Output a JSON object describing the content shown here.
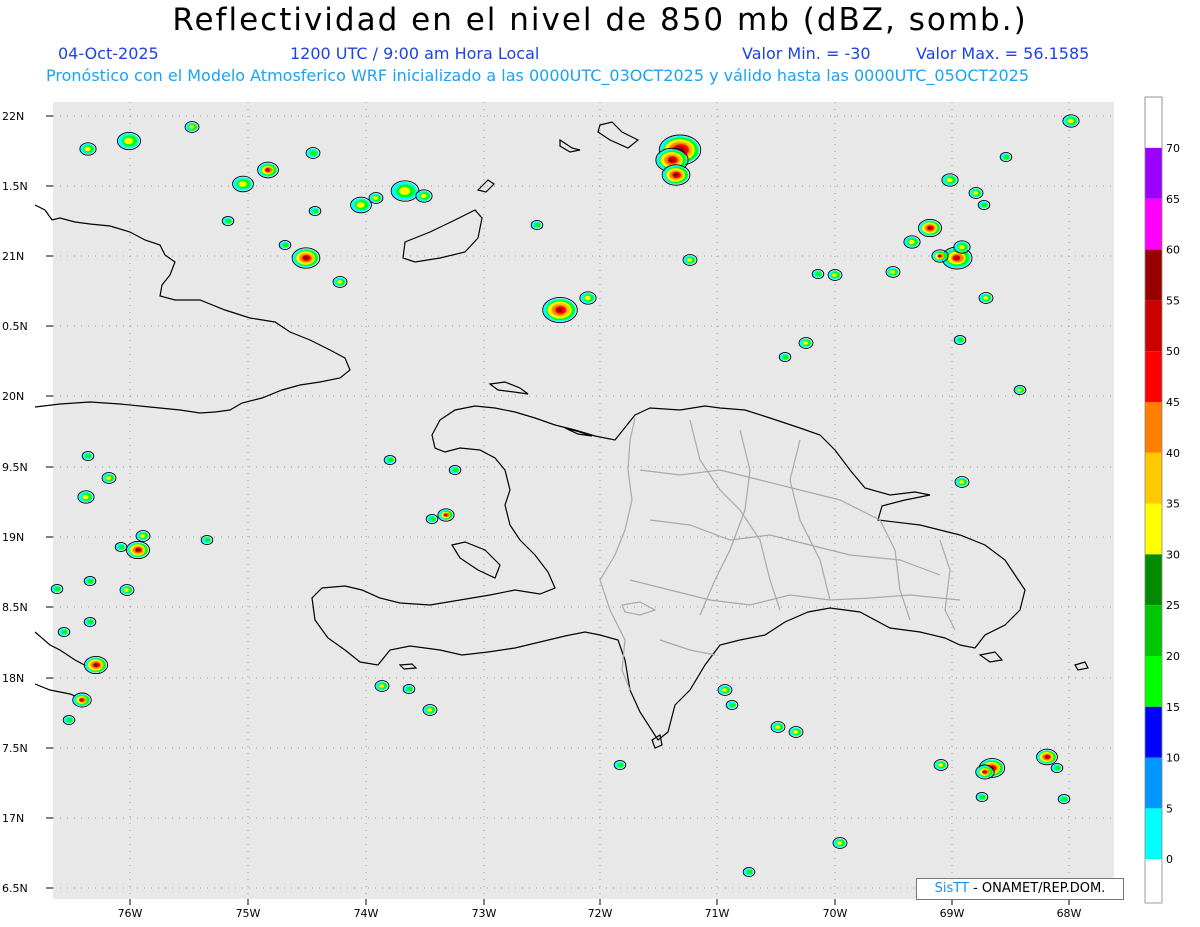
{
  "header": {
    "title": "Reflectividad en el nivel de 850 mb (dBZ, somb.)",
    "date": "04-Oct-2025",
    "time": "1200 UTC / 9:00 am Hora Local",
    "vmin": "Valor Min. = -30",
    "vmax": "Valor Max. = 56.1585",
    "forecast": "Pronóstico con el Modelo Atmosferico WRF inicializado a las 0000UTC_03OCT2025 y válido hasta las  0000UTC_05OCT2025"
  },
  "axes": {
    "lat_labels": [
      "22N",
      "1.5N",
      "21N",
      "0.5N",
      "20N",
      "9.5N",
      "19N",
      "8.5N",
      "18N",
      "7.5N",
      "17N",
      "6.5N"
    ],
    "lon_labels": [
      "76W",
      "75W",
      "74W",
      "73W",
      "72W",
      "71W",
      "70W",
      "69W",
      "68W"
    ]
  },
  "colorbar": {
    "labels": [
      "70",
      "65",
      "60",
      "55",
      "50",
      "45",
      "40",
      "35",
      "30",
      "25",
      "20",
      "15",
      "10",
      "5",
      "0"
    ],
    "colors": [
      "#9b00ff",
      "#ff00ff",
      "#990000",
      "#cc0000",
      "#ff0000",
      "#ff8000",
      "#ffc800",
      "#ffff00",
      "#008c00",
      "#00c800",
      "#00ff00",
      "#0000ff",
      "#0096ff",
      "#00ffff",
      "#ffffff"
    ],
    "below": "#e6e6e6"
  },
  "credit": {
    "brand": "SisTT",
    "text": " - ONAMET/REP.DOM."
  }
}
